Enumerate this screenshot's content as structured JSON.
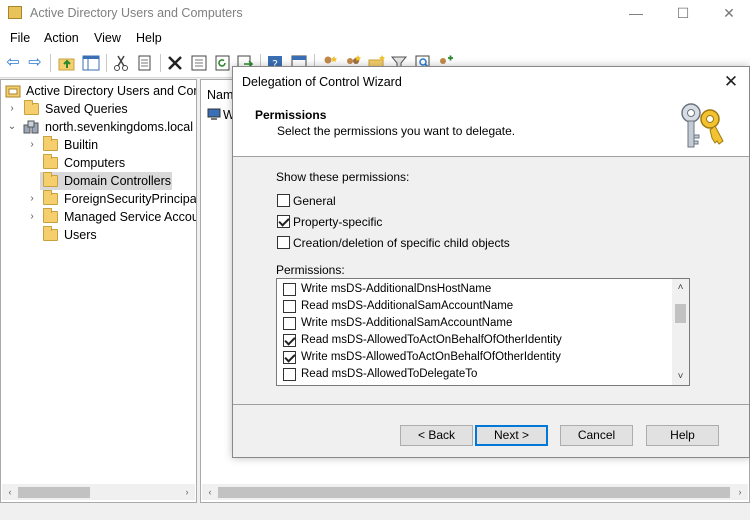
{
  "window": {
    "title": "Active Directory Users and Computers",
    "minimize_glyph": "—",
    "maximize_glyph": "☐",
    "close_glyph": "✕"
  },
  "menu": [
    "File",
    "Action",
    "View",
    "Help"
  ],
  "toolbar": {
    "icons": [
      "back-arrow-icon",
      "forward-arrow-icon",
      "up-folder-icon",
      "show-tree-icon",
      "cut-icon",
      "copy-icon",
      "delete-icon",
      "properties-icon",
      "refresh-icon",
      "export-icon",
      "help-icon",
      "mmc-icon",
      "new-user-icon",
      "new-group-icon",
      "filter-icon",
      "find-icon",
      "add-to-group-icon"
    ],
    "back_glyph": "⇦",
    "forward_glyph": "⇨"
  },
  "tree": {
    "root_label": "Active Directory Users and Com",
    "saved_queries": "Saved Queries",
    "domain": "north.sevenkingdoms.local",
    "children": [
      {
        "label": "Builtin",
        "expandable": true
      },
      {
        "label": "Computers",
        "expandable": false
      },
      {
        "label": "Domain Controllers",
        "expandable": false,
        "selected": true
      },
      {
        "label": "ForeignSecurityPrincipals",
        "expandable": true
      },
      {
        "label": "Managed Service Accour",
        "expandable": true
      },
      {
        "label": "Users",
        "expandable": false
      }
    ],
    "collapsed_glyph": "›",
    "expanded_glyph": "⌄"
  },
  "list": {
    "column_header": "Nam",
    "first_item": "W"
  },
  "dialog": {
    "title": "Delegation of Control Wizard",
    "close_glyph": "✕",
    "heading": "Permissions",
    "subheading": "Select the permissions you want to delegate.",
    "show_label": "Show these permissions:",
    "filters": [
      {
        "label": "General",
        "checked": false
      },
      {
        "label": "Property-specific",
        "checked": true
      },
      {
        "label": "Creation/deletion of specific child objects",
        "checked": false
      }
    ],
    "permissions_label": "Permissions:",
    "permissions": [
      {
        "label": "Write msDS-AdditionalDnsHostName",
        "checked": false
      },
      {
        "label": "Read msDS-AdditionalSamAccountName",
        "checked": false
      },
      {
        "label": "Write msDS-AdditionalSamAccountName",
        "checked": false
      },
      {
        "label": "Read msDS-AllowedToActOnBehalfOfOtherIdentity",
        "checked": true
      },
      {
        "label": "Write msDS-AllowedToActOnBehalfOfOtherIdentity",
        "checked": true
      },
      {
        "label": "Read msDS-AllowedToDelegateTo",
        "checked": false
      }
    ],
    "scroll_up_glyph": "˄",
    "scroll_down_glyph": "˅",
    "buttons": {
      "back": "< Back",
      "next": "Next >",
      "cancel": "Cancel",
      "help": "Help"
    }
  },
  "scroll": {
    "left_glyph": "‹",
    "right_glyph": "›"
  },
  "colors": {
    "accent": "#0078d7",
    "folder": "#f5cf6d",
    "selection": "#d9d9d9"
  }
}
